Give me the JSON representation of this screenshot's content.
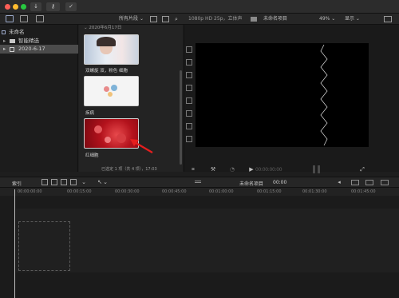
{
  "window": {
    "traffic_lights": {
      "close": "#fe5f57",
      "minimize": "#febc2e",
      "zoom": "#28c840"
    },
    "buttons": [
      {
        "name": "download-arrow-button",
        "glyph": "↓"
      },
      {
        "name": "key-button",
        "glyph": "⚷"
      },
      {
        "name": "check-button",
        "glyph": "✓"
      }
    ]
  },
  "browser_toolbar": {
    "filter_label": "所有片段",
    "filter_arrow": "⌄"
  },
  "viewer_toolbar": {
    "format": "1080p HD 25p，立体声",
    "project_name": "未命名项目",
    "zoom": "49%",
    "view_menu": "显示"
  },
  "library": {
    "root": "未命名",
    "items": [
      {
        "label": "智能精选",
        "selected": false
      },
      {
        "label": "2020-6-17",
        "selected": true
      }
    ]
  },
  "browser": {
    "date_header": "2020年6月17日",
    "clips": [
      {
        "label": "双螺旋 双，粉色 细胞"
      },
      {
        "label": "疾病"
      },
      {
        "label": "红细胞"
      }
    ],
    "status": "已选定 1 项（共 4 项），17:03"
  },
  "viewer": {
    "timecode": "00:00:00:00"
  },
  "timeline_header": {
    "index_label": "索引",
    "project_name": "未命名项目",
    "duration": "00:00"
  },
  "ruler_ticks": [
    "00:00:00:00",
    "00:00:15:00",
    "00:00:30:00",
    "00:00:45:00",
    "00:01:00:00",
    "00:01:15:00",
    "00:01:30:00",
    "00:01:45:00"
  ]
}
